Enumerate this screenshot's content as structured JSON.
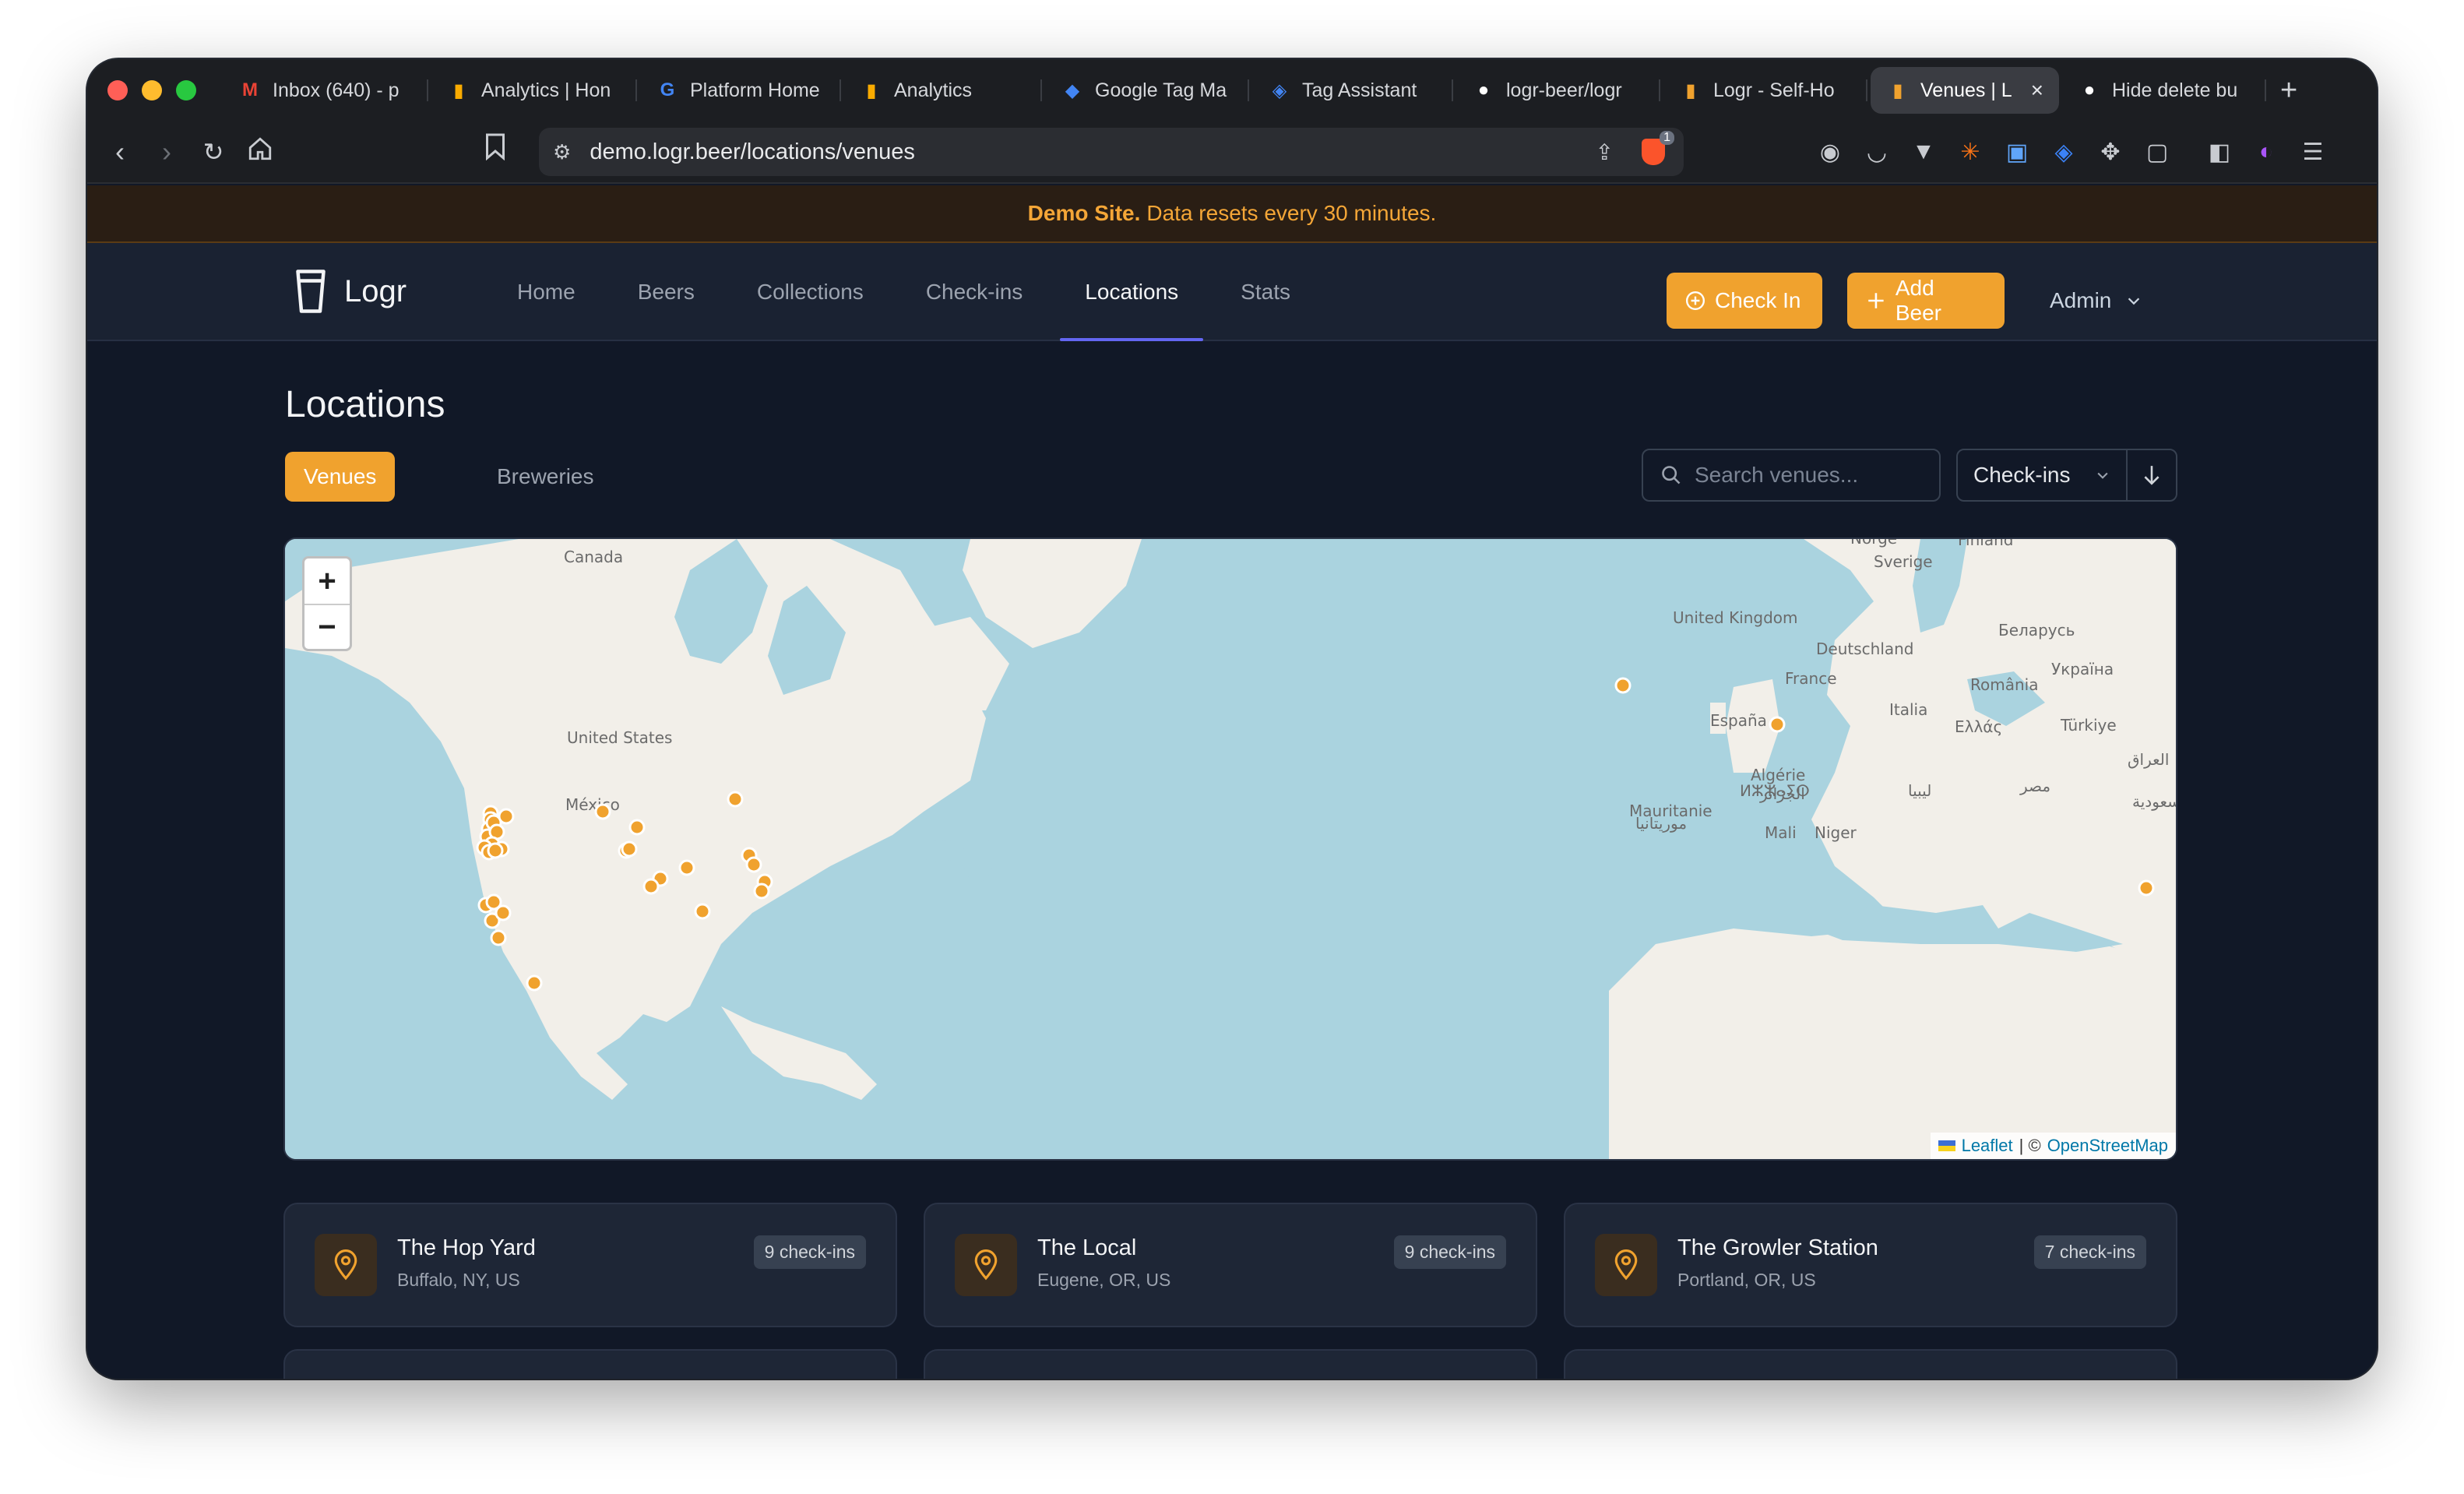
{
  "browser": {
    "tabs": [
      {
        "title": "Inbox (640) - p",
        "icon": "gmail-icon",
        "glyph": "M",
        "color": "#ea4335"
      },
      {
        "title": "Analytics | Hon",
        "icon": "analytics-icon",
        "glyph": "▮",
        "color": "#f9ab00"
      },
      {
        "title": "Platform Home",
        "icon": "google-icon",
        "glyph": "G",
        "color": "#4285f4"
      },
      {
        "title": "Analytics",
        "icon": "analytics-icon",
        "glyph": "▮",
        "color": "#f9ab00"
      },
      {
        "title": "Google Tag Ma",
        "icon": "tag-manager-icon",
        "glyph": "◆",
        "color": "#4285f4"
      },
      {
        "title": "Tag Assistant",
        "icon": "tag-assistant-icon",
        "glyph": "◈",
        "color": "#4285f4"
      },
      {
        "title": "logr-beer/logr",
        "icon": "github-icon",
        "glyph": "●",
        "color": "#ffffff"
      },
      {
        "title": "Logr - Self-Ho",
        "icon": "logr-icon",
        "glyph": "▮",
        "color": "#f0a22e"
      },
      {
        "title": "Venues | L",
        "icon": "logr-icon",
        "glyph": "▮",
        "color": "#f0a22e",
        "active": true
      },
      {
        "title": "Hide delete bu",
        "icon": "github-icon",
        "glyph": "●",
        "color": "#ffffff"
      }
    ],
    "url": "demo.logr.beer/locations/venues",
    "shield_badge": "1"
  },
  "banner": {
    "strong": "Demo Site.",
    "text": "Data resets every 30 minutes."
  },
  "header": {
    "brand": "Logr",
    "nav": [
      "Home",
      "Beers",
      "Collections",
      "Check-ins",
      "Locations",
      "Stats"
    ],
    "active_nav": "Locations",
    "check_in_label": "Check In",
    "add_beer_label": "Add Beer",
    "user_label": "Admin"
  },
  "page": {
    "title": "Locations",
    "tab_venues": "Venues",
    "tab_breweries": "Breweries",
    "search_placeholder": "Search venues...",
    "sort_label": "Check-ins"
  },
  "map": {
    "labels": {
      "canada": "Canada",
      "united_states": "United States",
      "mexico": "México",
      "united_kingdom": "United Kingdom",
      "deutschland": "Deutschland",
      "france": "France",
      "espana": "España",
      "italia": "Italia",
      "ellas": "Ελλάς",
      "romania": "România",
      "ukraina": "Україна",
      "belarus": "Беларусь",
      "sverige": "Sverige",
      "finland": "Finland",
      "norge": "Norge",
      "turkiye": "Türkiye",
      "algerie": "Algérie",
      "algerie_ar": "الجزائر",
      "algerie_tz": "ⵍⵣⵣⴰⵢⵔ",
      "libya": "ليبيا",
      "misr": "مصر",
      "iraq": "العراق",
      "saudi": "السعودية",
      "mauritanie": "Mauritanie",
      "mauritania_ar": "موريتانيا",
      "mali": "Mali",
      "niger": "Niger"
    },
    "attribution_leaflet": "Leaflet",
    "attribution_sep": "| ©",
    "attribution_osm": "OpenStreetMap",
    "zoom_in": "+",
    "zoom_out": "−"
  },
  "venues": [
    {
      "name": "The Hop Yard",
      "location": "Buffalo, NY, US",
      "count": "9 check-ins"
    },
    {
      "name": "The Local",
      "location": "Eugene, OR, US",
      "count": "9 check-ins"
    },
    {
      "name": "The Growler Station",
      "location": "Portland, OR, US",
      "count": "7 check-ins"
    }
  ],
  "colors": {
    "accent": "#f0a22e",
    "bg": "#111827",
    "header": "#1a2232",
    "card": "#1e2636",
    "active_underline": "#6366f1"
  }
}
